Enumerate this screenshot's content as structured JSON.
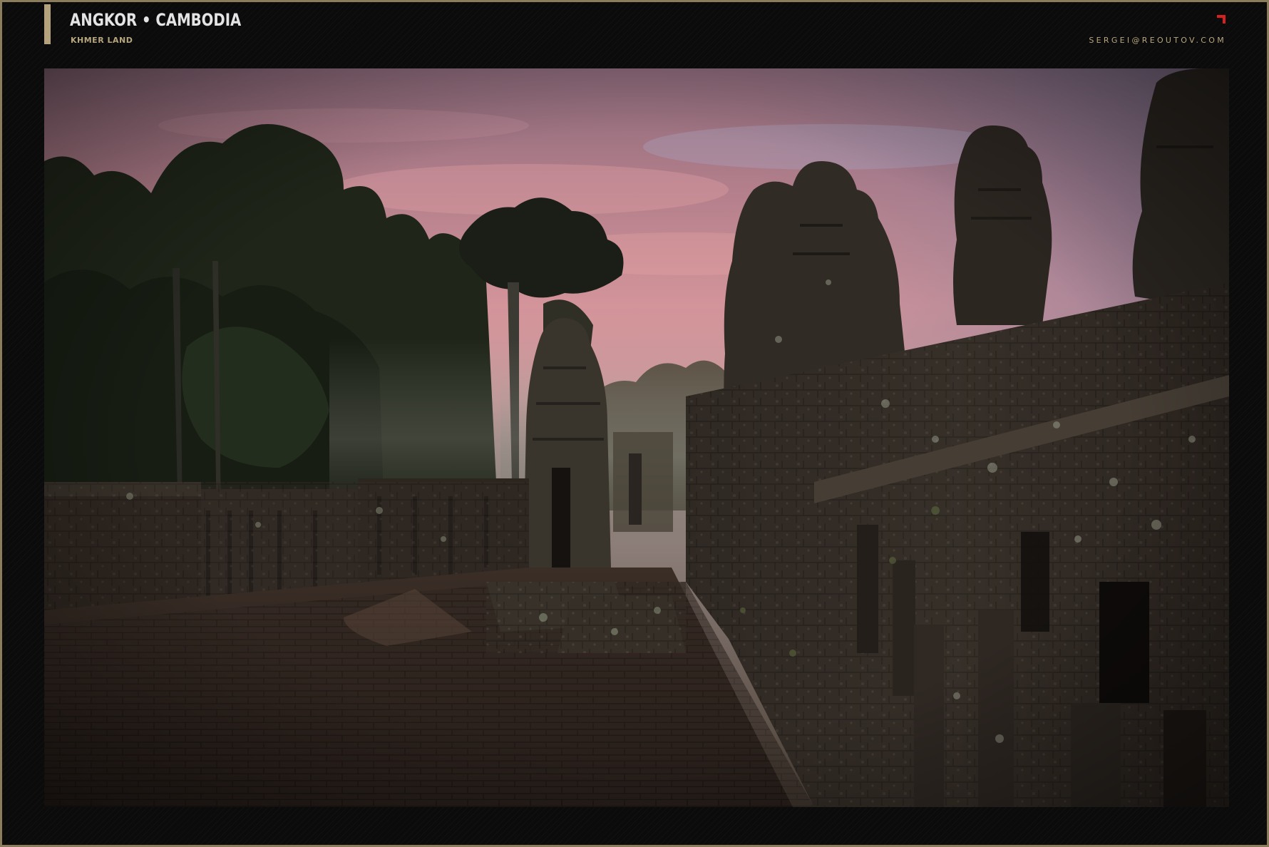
{
  "header": {
    "title_part1": "ANGKOR",
    "title_separator": "•",
    "title_part2": "CAMBODIA",
    "subtitle": "KHMER LAND",
    "email": "SERGEI@REOUTOV.COM"
  },
  "colors": {
    "border": "#8b7d5c",
    "accent": "#b3a27c",
    "corner_mark": "#d8201f",
    "title": "#e4e4e4",
    "background": "#0b0b0b"
  },
  "icons": {
    "corner_mark": "red-corner-bracket-icon"
  },
  "photo": {
    "subject": "temple"
  }
}
